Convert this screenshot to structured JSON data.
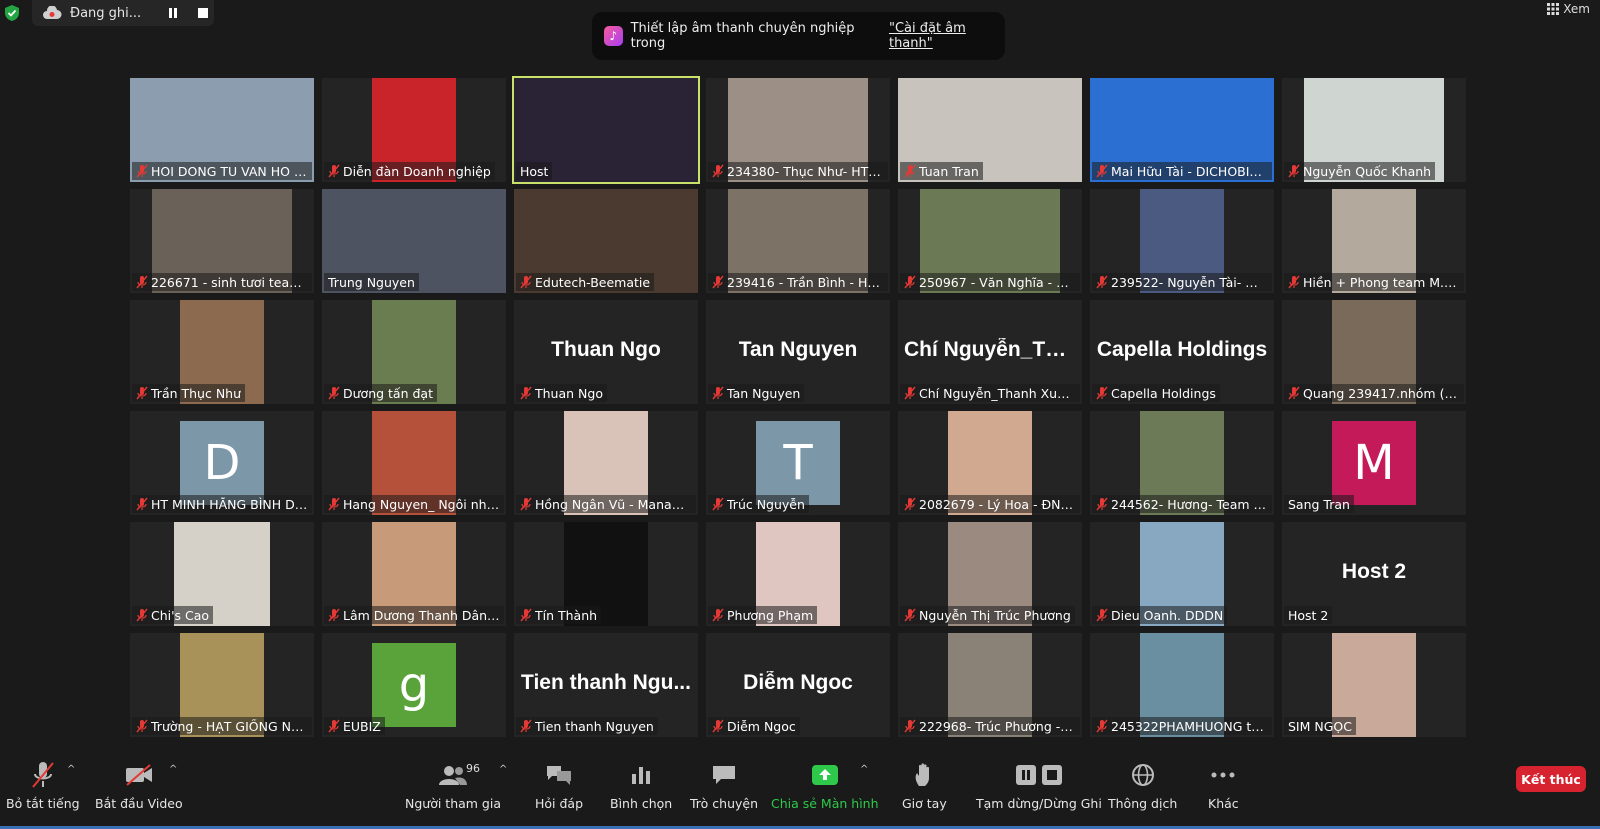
{
  "recording": {
    "label": "Đang ghi..."
  },
  "view": {
    "label": "Xem"
  },
  "banner": {
    "text": "Thiết lập âm thanh chuyên nghiệp trong",
    "link": "\"Cài đặt âm thanh\""
  },
  "tiles": [
    {
      "name": "HOI DONG TU VAN HO T...",
      "muted": true,
      "kind": "video",
      "bg": "#8c9db0",
      "w": "full"
    },
    {
      "name": "Diễn đàn Doanh nghiệp",
      "muted": true,
      "kind": "video",
      "bg": "#c9242a",
      "w": "w84"
    },
    {
      "name": "Host",
      "muted": false,
      "kind": "video",
      "bg": "#2a2235",
      "w": "full",
      "active": true
    },
    {
      "name": "234380- Thục Như- HT M...",
      "muted": true,
      "kind": "video",
      "bg": "#9c8f86",
      "w": "w140"
    },
    {
      "name": "Tuan Tran",
      "muted": true,
      "kind": "video",
      "bg": "#c8c3bd",
      "w": "full"
    },
    {
      "name": "Mai Hữu Tài - DICHOBIET...",
      "muted": true,
      "kind": "video",
      "bg": "#2a6fd1",
      "w": "full"
    },
    {
      "name": "Nguyễn Quốc Khanh",
      "muted": true,
      "kind": "video",
      "bg": "#cfd6d2",
      "w": "w140"
    },
    {
      "name": "226671 - sinh tươi team ...",
      "muted": true,
      "kind": "video",
      "bg": "#6a6158",
      "w": "w140"
    },
    {
      "name": "Trung Nguyen",
      "muted": false,
      "kind": "video",
      "bg": "#4d5361",
      "w": "full"
    },
    {
      "name": "Edutech-Beematie",
      "muted": true,
      "kind": "video",
      "bg": "#4a3a30",
      "w": "full"
    },
    {
      "name": "239416 - Trần Bình - HT T...",
      "muted": true,
      "kind": "video",
      "bg": "#7d7266",
      "w": "w140"
    },
    {
      "name": "250967 - Văn Nghĩa - HT ...",
      "muted": true,
      "kind": "video",
      "bg": "#6b7a55",
      "w": "w140"
    },
    {
      "name": "239522- Nguyễn Tài- MH...",
      "muted": true,
      "kind": "video",
      "bg": "#4a5a80",
      "w": "w84"
    },
    {
      "name": "Hiền + Phong team M.Hả...",
      "muted": true,
      "kind": "video",
      "bg": "#b3a99c",
      "w": "w84"
    },
    {
      "name": "Trần Thục Như",
      "muted": true,
      "kind": "video",
      "bg": "#8c6a50",
      "w": "w84"
    },
    {
      "name": "Dương tấn đạt",
      "muted": true,
      "kind": "video",
      "bg": "#6a7d50",
      "w": "w84"
    },
    {
      "name": "Thuan Ngo",
      "muted": true,
      "kind": "text",
      "display": "Thuan Ngo"
    },
    {
      "name": "Tan Nguyen",
      "muted": true,
      "kind": "text",
      "display": "Tan Nguyen"
    },
    {
      "name": "Chí Nguyễn_Thanh Xuân-...",
      "muted": true,
      "kind": "text",
      "display": "Chí  Nguyễn_Tha..."
    },
    {
      "name": "Capella Holdings",
      "muted": true,
      "kind": "text",
      "display": "Capella Holdings"
    },
    {
      "name": "Quang 239417.nhóm (M...",
      "muted": true,
      "kind": "video",
      "bg": "#7a6a5a",
      "w": "w84"
    },
    {
      "name": "HT MINH HẰNG BÌNH DƯ...",
      "muted": true,
      "kind": "avatar",
      "letter": "D",
      "bg": "#7b97a8"
    },
    {
      "name": "Hang Nguyen_ Ngôi nhà ...",
      "muted": true,
      "kind": "video",
      "bg": "#b5503a",
      "w": "w84"
    },
    {
      "name": "Hồng Ngân Vũ  - Manang...",
      "muted": true,
      "kind": "video",
      "bg": "#d9c3b8",
      "w": "w84"
    },
    {
      "name": "Trúc Nguyễn",
      "muted": true,
      "kind": "avatar",
      "letter": "T",
      "bg": "#7b97a8"
    },
    {
      "name": "2082679 - Lý Hoa - ĐN H...",
      "muted": true,
      "kind": "video",
      "bg": "#d1a990",
      "w": "w84"
    },
    {
      "name": "244562- Hương- Team M...",
      "muted": true,
      "kind": "video",
      "bg": "#6d7a58",
      "w": "w84"
    },
    {
      "name": "Sang Tran",
      "muted": false,
      "kind": "avatar",
      "letter": "M",
      "bg": "#c41a5a"
    },
    {
      "name": "Chi's Cao",
      "muted": true,
      "kind": "video",
      "bg": "#d5d1c8",
      "w": "w96"
    },
    {
      "name": "Lâm Dương Thanh Dân- ...",
      "muted": true,
      "kind": "video",
      "bg": "#c79a7a",
      "w": "w84"
    },
    {
      "name": "Tín Thành",
      "muted": true,
      "kind": "video",
      "bg": "#111111",
      "w": "w84"
    },
    {
      "name": "Phương Phạm",
      "muted": true,
      "kind": "video",
      "bg": "#e0c6c0",
      "w": "w84"
    },
    {
      "name": "Nguyễn Thị Trúc Phương",
      "muted": true,
      "kind": "video",
      "bg": "#9a8a80",
      "w": "w84"
    },
    {
      "name": "Dieu Oanh. DDDN",
      "muted": true,
      "kind": "video",
      "bg": "#88a7c0",
      "w": "w84"
    },
    {
      "name": "Host 2",
      "muted": false,
      "kind": "text",
      "display": "Host 2"
    },
    {
      "name": "Trường - HẠT GIỐNG NẢY M...",
      "muted": true,
      "kind": "video",
      "bg": "#a8925a",
      "w": "w84"
    },
    {
      "name": "EUBIZ",
      "muted": true,
      "kind": "avatar",
      "letter": "g",
      "bg": "#5aa33a"
    },
    {
      "name": "Tien thanh Nguyen",
      "muted": true,
      "kind": "text",
      "display": "Tien thanh Ngu..."
    },
    {
      "name": "Diễm Ngoc",
      "muted": true,
      "kind": "text",
      "display": "Diễm Ngoc"
    },
    {
      "name": "222968- Trúc Phương -M...",
      "muted": true,
      "kind": "video",
      "bg": "#8a8276",
      "w": "w84"
    },
    {
      "name": "245322PHAMHUONG te...",
      "muted": true,
      "kind": "video",
      "bg": "#6a8fa0",
      "w": "w84"
    },
    {
      "name": "SIM NGỌC",
      "muted": false,
      "kind": "video",
      "bg": "#c9a999",
      "w": "w84"
    }
  ],
  "toolbar": {
    "mute": "Bỏ tắt tiếng",
    "video": "Bắt đầu Video",
    "participants": "Người tham gia",
    "participants_count": "96",
    "qa": "Hỏi đáp",
    "poll": "Bình chọn",
    "chat": "Trò chuyện",
    "share": "Chia sẻ Màn hình",
    "raise_hand": "Giơ tay",
    "record": "Tạm dừng/Dừng Ghi",
    "interpretation": "Thông dịch",
    "more": "Khác",
    "end": "Kết thúc"
  },
  "colors": {
    "share": "#2ec94a",
    "end": "#d6232f",
    "active_border": "#c9e26a"
  }
}
